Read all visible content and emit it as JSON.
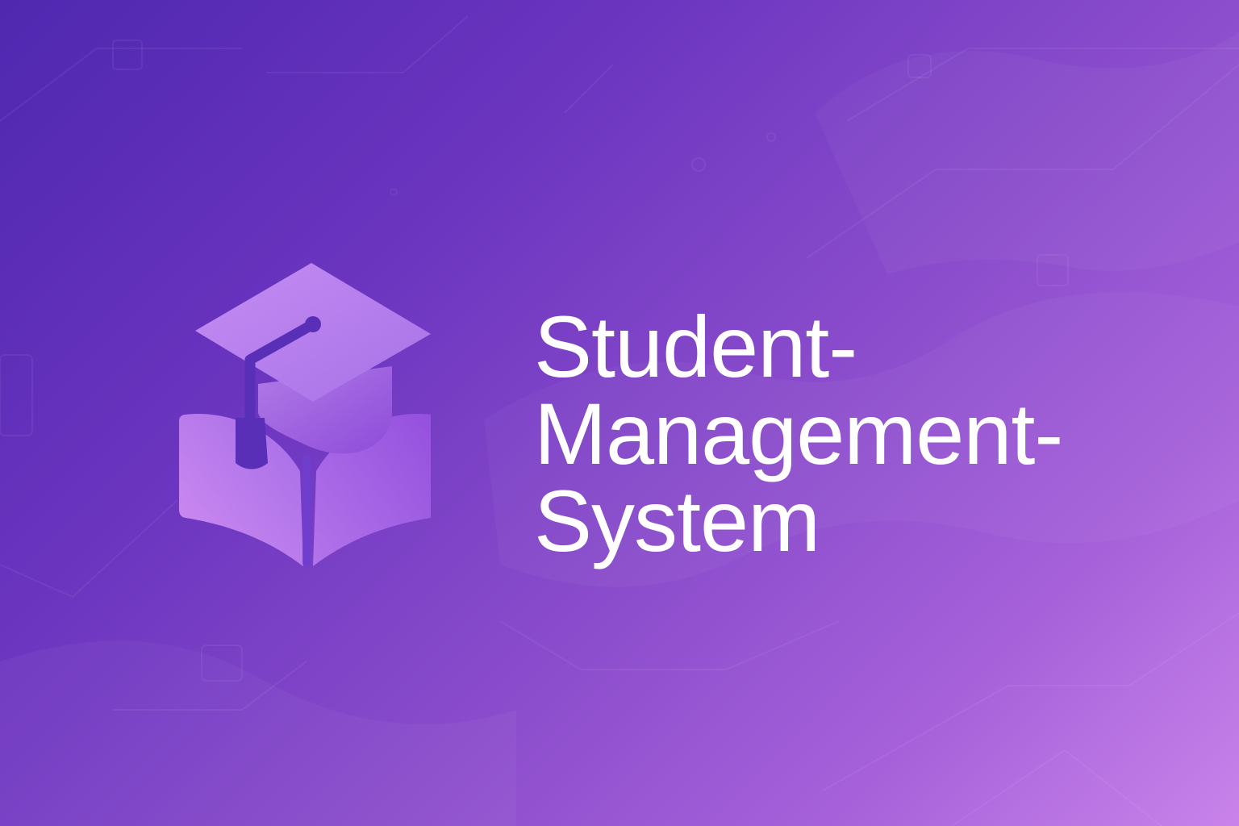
{
  "brand": {
    "title_lines": [
      "Student-",
      "Management-",
      "System"
    ]
  },
  "icons": {
    "logo": "graduation-cap-on-open-book-icon"
  },
  "colors": {
    "background_start": "#4f28b0",
    "background_end": "#c983ea",
    "logo_light": "#cc8cf0",
    "logo_dark": "#9450de",
    "logo_accent": "#5a2fb8",
    "text": "#ffffff"
  }
}
